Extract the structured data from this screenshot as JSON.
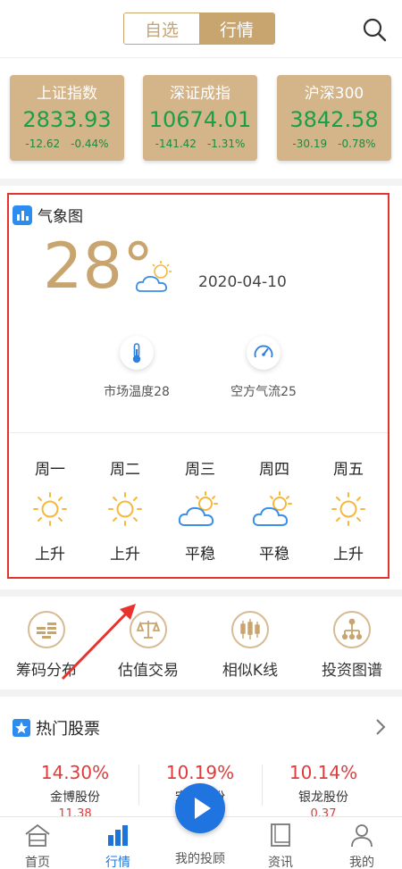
{
  "header": {
    "tabs": [
      {
        "label": "自选",
        "active": false
      },
      {
        "label": "行情",
        "active": true
      }
    ],
    "search_icon": "search-icon"
  },
  "indices": [
    {
      "name": "上证指数",
      "value": "2833.93",
      "change": "-12.62",
      "pct": "-0.44%"
    },
    {
      "name": "深证成指",
      "value": "10674.01",
      "change": "-141.42",
      "pct": "-1.31%"
    },
    {
      "name": "沪深300",
      "value": "3842.58",
      "change": "-30.19",
      "pct": "-0.78%"
    }
  ],
  "weather": {
    "title": "气象图",
    "temperature": "28°",
    "date": "2020-04-10",
    "indicators": [
      {
        "label": "市场温度28",
        "icon": "thermometer-icon"
      },
      {
        "label": "空方气流25",
        "icon": "gauge-icon"
      }
    ],
    "days": [
      {
        "day": "周一",
        "icon": "sun-icon",
        "status": "上升"
      },
      {
        "day": "周二",
        "icon": "sun-icon",
        "status": "上升"
      },
      {
        "day": "周三",
        "icon": "cloud-sun-icon",
        "status": "平稳"
      },
      {
        "day": "周四",
        "icon": "cloud-sun-icon",
        "status": "平稳"
      },
      {
        "day": "周五",
        "icon": "sun-icon",
        "status": "上升"
      }
    ]
  },
  "tools": [
    {
      "label": "筹码分布",
      "icon": "chips-icon"
    },
    {
      "label": "估值交易",
      "icon": "scale-icon"
    },
    {
      "label": "相似K线",
      "icon": "candlestick-icon"
    },
    {
      "label": "投资图谱",
      "icon": "tree-icon"
    }
  ],
  "hot": {
    "title": "热门股票",
    "stocks": [
      {
        "pct": "14.30%",
        "name": "金博股份",
        "price": "11.38"
      },
      {
        "pct": "10.19%",
        "name": "宏达股份",
        "price": ""
      },
      {
        "pct": "10.14%",
        "name": "银龙股份",
        "price": "0.37"
      }
    ]
  },
  "nav": [
    {
      "label": "首页",
      "icon": "home-icon",
      "active": false
    },
    {
      "label": "行情",
      "icon": "market-icon",
      "active": true
    },
    {
      "label": "我的投顾",
      "icon": "play-icon",
      "active": false
    },
    {
      "label": "资讯",
      "icon": "news-icon",
      "active": false
    },
    {
      "label": "我的",
      "icon": "profile-icon",
      "active": false
    }
  ],
  "colors": {
    "gold": "#c8a46e",
    "card_bg": "#d4b489",
    "green": "#18a048",
    "red": "#e23a3a",
    "blue": "#1f74e0",
    "highlight": "#e8322e"
  }
}
